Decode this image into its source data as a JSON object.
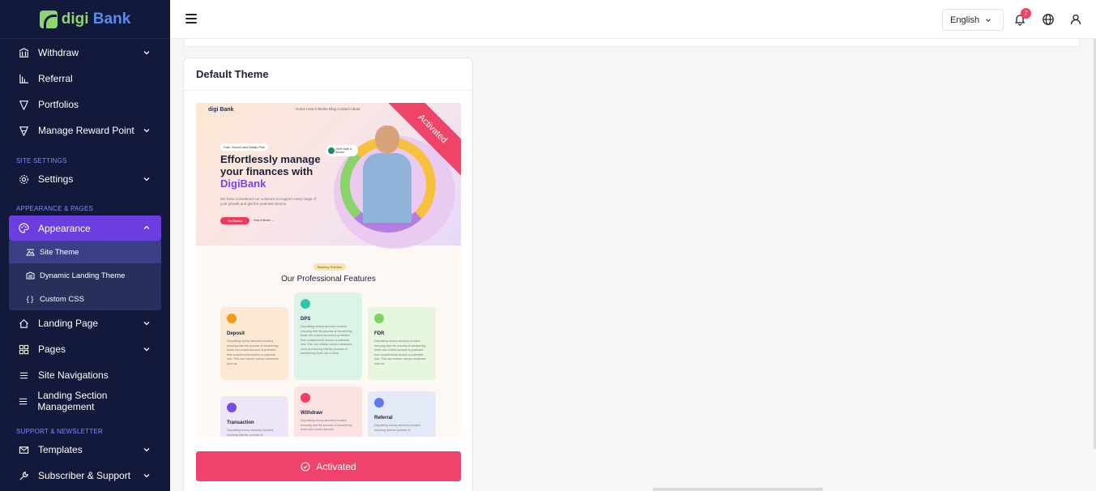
{
  "brand": {
    "part1": "digi",
    "part2": " Bank"
  },
  "sidebar": {
    "items": [
      {
        "label": "Withdraw"
      },
      {
        "label": "Referral"
      },
      {
        "label": "Portfolios"
      },
      {
        "label": "Manage Reward Point"
      }
    ],
    "section_site_settings": "SITE SETTINGS",
    "settings": {
      "label": "Settings"
    },
    "section_appearance": "APPEARANCE & PAGES",
    "appearance": {
      "label": "Appearance"
    },
    "appearance_sub": [
      {
        "label": "Site Theme"
      },
      {
        "label": "Dynamic Landing Theme"
      },
      {
        "label": "Custom CSS"
      }
    ],
    "landing_page": {
      "label": "Landing Page"
    },
    "pages": {
      "label": "Pages"
    },
    "site_navigations": {
      "label": "Site Navigations"
    },
    "landing_section": {
      "label": "Landing Section Management"
    },
    "section_support": "SUPPORT & NEWSLETTER",
    "templates": {
      "label": "Templates"
    },
    "subscriber": {
      "label": "Subscriber & Support"
    }
  },
  "header": {
    "language": "English",
    "notification_count": "7"
  },
  "card": {
    "title": "Default Theme",
    "ribbon": "Activated",
    "button_label": "Activated"
  },
  "preview": {
    "logo": "digi Bank",
    "nav": "Home    How it Works    Blog    Contact    About",
    "pill": "Fast, Secure and Easily Pick",
    "headline_1": "Effortlessly manage your finances with",
    "headline_accent": "DigiBank",
    "paragraph": "We have considered our solutions to support every stage of your growth and get the potential service.",
    "button": "Get Started",
    "link": "How It Works →",
    "safe": "100% Safe & Secure",
    "features_tag": "Banking Solution",
    "features_title": "Our Professional Features",
    "features": [
      {
        "title": "Deposit",
        "text": "Depositing money securely involves ensuring that the process of transferring funds into a bank account is protected from unauthorized access or potential loss. This can include various measures such as",
        "color": "#fbe9d3",
        "icon": "#f29a1e"
      },
      {
        "title": "DPS",
        "text": "Depositing money securely involves ensuring that the process of transferring funds into a bank account is protected from unauthorized access or potential loss. This can include various measures such as ensuring that the process of transferring funds into a bank",
        "color": "#dcf4e8",
        "icon": "#2ec9a0"
      },
      {
        "title": "FDR",
        "text": "Depositing money securely involves ensuring that the process of transferring funds into a bank account is protected from unauthorized access or potential loss. This can include various measures such as",
        "color": "#e6f6df",
        "icon": "#7fd35c"
      },
      {
        "title": "Transaction",
        "text": "Depositing money securely involves ensuring that the process of",
        "color": "#ece6f8",
        "icon": "#7a4be0"
      },
      {
        "title": "Withdraw",
        "text": "Depositing money securely involves ensuring that the process of transferring funds into a bank account",
        "color": "#fbe3e4",
        "icon": "#ef4063"
      },
      {
        "title": "Referral",
        "text": "Depositing money securely involves ensuring that the process of",
        "color": "#e4e9f8",
        "icon": "#5a7cf0"
      }
    ]
  }
}
